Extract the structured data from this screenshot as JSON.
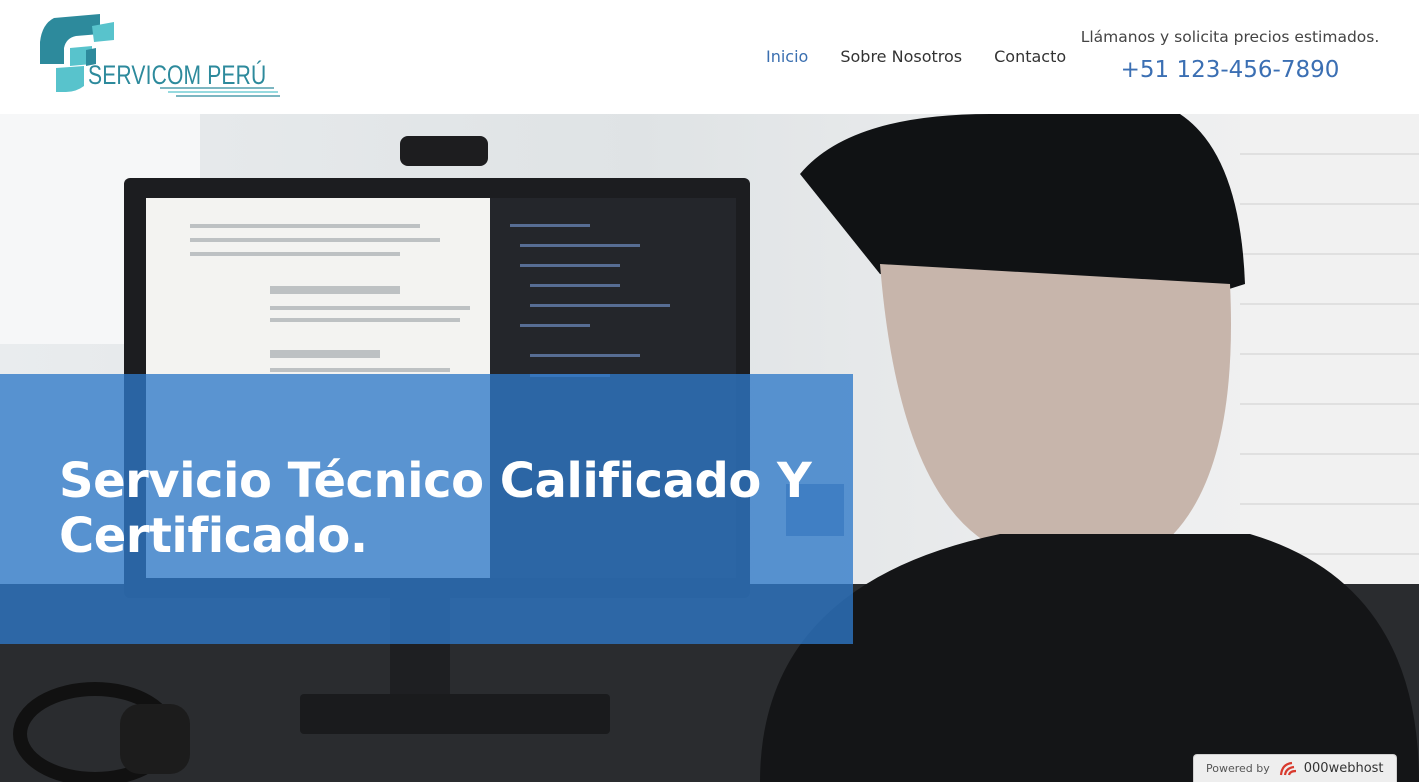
{
  "header": {
    "logo_text": "SERVICOM PERÚ",
    "nav": [
      {
        "label": "Inicio",
        "active": true
      },
      {
        "label": "Sobre Nosotros",
        "active": false
      },
      {
        "label": "Contacto",
        "active": false
      }
    ],
    "contact_tagline": "Llámanos y solicita precios estimados.",
    "phone": "+51 123-456-7890"
  },
  "hero": {
    "title": "Servicio Técnico Calificado Y Certificado.",
    "overlay_color": "#2e78c8"
  },
  "badge": {
    "powered_label": "Powered by",
    "brand_label": "000webhost"
  },
  "colors": {
    "accent": "#3b6fb3",
    "logo_teal": "#2d8a9c",
    "logo_light": "#58c3cc"
  },
  "icons": {
    "logo_mark": "servicom-logo-icon",
    "brand_mark": "000webhost-logo-icon"
  }
}
